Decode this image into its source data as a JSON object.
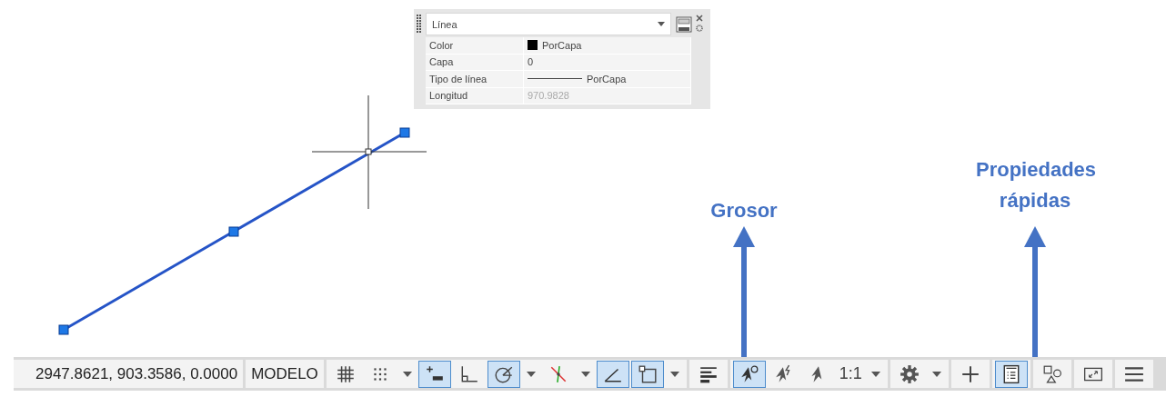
{
  "palette": {
    "object_type": "Línea",
    "rows": [
      {
        "label": "Color",
        "value": "PorCapa",
        "kind": "color",
        "color": "#000000",
        "readonly": false
      },
      {
        "label": "Capa",
        "value": "0",
        "kind": "text",
        "readonly": false
      },
      {
        "label": "Tipo de línea",
        "value": "PorCapa",
        "kind": "linetype",
        "readonly": false
      },
      {
        "label": "Longitud",
        "value": "970.9828",
        "kind": "text",
        "readonly": true
      }
    ]
  },
  "annotations": [
    {
      "label": "Grosor"
    },
    {
      "label": "Propiedades rápidas"
    }
  ],
  "status_bar": {
    "coordinates": "2947.8621, 903.3586, 0.0000",
    "space": "MODELO",
    "groups": [
      {
        "items": [
          {
            "kind": "grid",
            "on": false
          },
          {
            "kind": "snap",
            "on": false
          },
          {
            "kind": "caret"
          },
          {
            "kind": "infer",
            "on": true
          },
          {
            "kind": "ortho",
            "on": false
          },
          {
            "kind": "polar",
            "on": true
          },
          {
            "kind": "caret"
          },
          {
            "kind": "isodraft",
            "on": false
          },
          {
            "kind": "caret"
          },
          {
            "kind": "otrack",
            "on": true
          },
          {
            "kind": "osnap",
            "on": true
          },
          {
            "kind": "caret"
          }
        ]
      },
      {
        "items": [
          {
            "kind": "lineweight",
            "on": false
          }
        ]
      },
      {
        "items": [
          {
            "kind": "annovis",
            "on": true
          },
          {
            "kind": "autoscale",
            "on": false
          },
          {
            "kind": "annoscale",
            "on": false
          },
          {
            "kind": "scale",
            "label": "1:1"
          },
          {
            "kind": "caret"
          }
        ]
      },
      {
        "items": [
          {
            "kind": "gear"
          },
          {
            "kind": "caret"
          }
        ]
      },
      {
        "items": [
          {
            "kind": "plus",
            "on": false
          }
        ]
      },
      {
        "items": [
          {
            "kind": "quickprops",
            "on": true
          }
        ]
      },
      {
        "items": [
          {
            "kind": "selcycle",
            "on": false
          }
        ]
      },
      {
        "items": [
          {
            "kind": "fullscreen",
            "on": false
          }
        ]
      },
      {
        "items": [
          {
            "kind": "menu"
          }
        ]
      }
    ]
  }
}
